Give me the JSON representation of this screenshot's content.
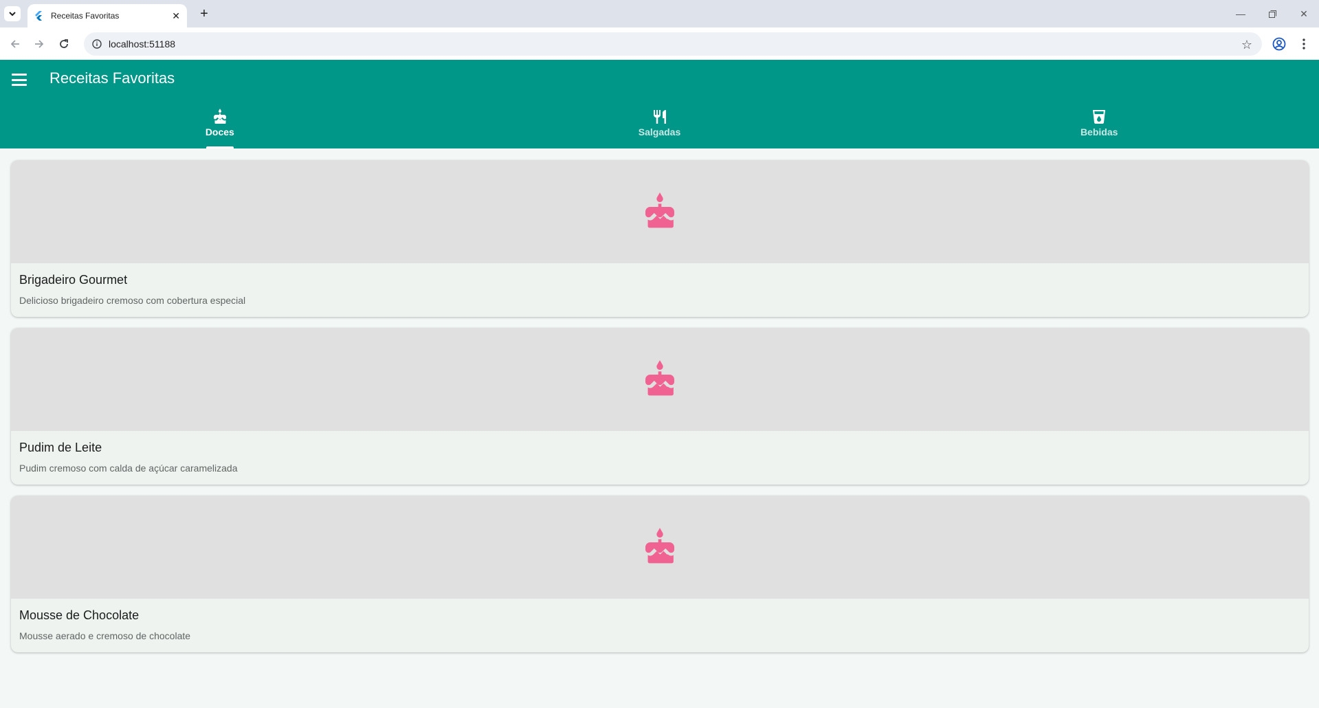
{
  "browser": {
    "tab_title": "Receitas Favoritas",
    "url": "localhost:51188"
  },
  "app": {
    "title": "Receitas Favoritas",
    "tabs": [
      {
        "label": "Doces",
        "icon": "cake-icon",
        "active": true
      },
      {
        "label": "Salgadas",
        "icon": "restaurant-icon",
        "active": false
      },
      {
        "label": "Bebidas",
        "icon": "local-drink-icon",
        "active": false
      }
    ],
    "accent_color": "#009688",
    "icon_color": "#f06292"
  },
  "recipes": [
    {
      "title": "Brigadeiro Gourmet",
      "description": "Delicioso brigadeiro cremoso com cobertura especial",
      "icon": "cake-icon"
    },
    {
      "title": "Pudim de Leite",
      "description": "Pudim cremoso com calda de açúcar caramelizada",
      "icon": "cake-icon"
    },
    {
      "title": "Mousse de Chocolate",
      "description": "Mousse aerado e cremoso de chocolate",
      "icon": "cake-icon"
    }
  ]
}
